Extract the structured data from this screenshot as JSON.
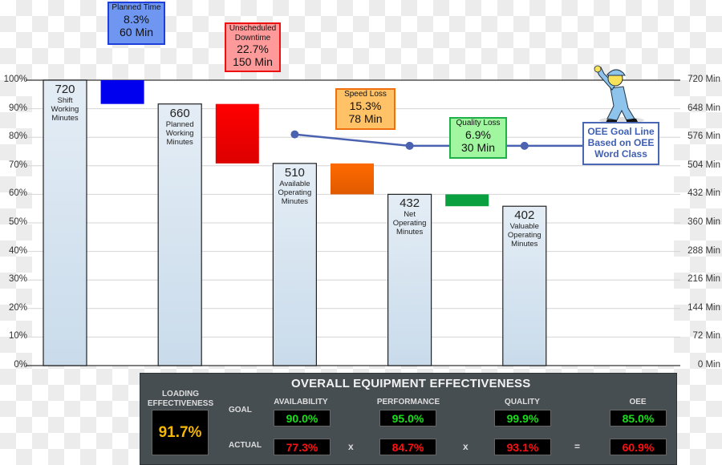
{
  "chart_data": {
    "type": "bar",
    "subtype": "waterfall",
    "title": "Overall Equipment Effectiveness",
    "left_axis": {
      "ticks": [
        "0%",
        "10%",
        "20%",
        "30%",
        "40%",
        "50%",
        "60%",
        "70%",
        "80%",
        "90%",
        "100%"
      ],
      "range": [
        0,
        100
      ]
    },
    "right_axis": {
      "ticks": [
        "0 Min",
        "72 Min",
        "144 Min",
        "216 Min",
        "288 Min",
        "360 Min",
        "432 Min",
        "504 Min",
        "576 Min",
        "648 Min",
        "720 Min"
      ],
      "range": [
        0,
        720
      ]
    },
    "grid": true,
    "bars": [
      {
        "kind": "total",
        "value": 720,
        "label": "720",
        "desc": [
          "Shift",
          "Working",
          "Minutes"
        ],
        "color": "#d6e4f0"
      },
      {
        "kind": "loss",
        "from": 720,
        "to": 660,
        "color": "#0000ee",
        "callout": {
          "title": "Planned Time",
          "pct": "8.3%",
          "min": "60 Min",
          "bg": "#6f96f0",
          "border": "#1f3fdd"
        }
      },
      {
        "kind": "total",
        "value": 660,
        "label": "660",
        "desc": [
          "Planned",
          "Working",
          "Minutes"
        ],
        "color": "#d6e4f0"
      },
      {
        "kind": "loss",
        "from": 660,
        "to": 510,
        "color": "#ee0000",
        "callout": {
          "title": "Unscheduled Downtime",
          "pct": "22.7%",
          "min": "150 Min",
          "bg": "#ff9a9a",
          "border": "#ee1111"
        }
      },
      {
        "kind": "total",
        "value": 510,
        "label": "510",
        "desc": [
          "Available",
          "Operating",
          "Minutes"
        ],
        "color": "#d6e4f0"
      },
      {
        "kind": "loss",
        "from": 510,
        "to": 432,
        "color": "#f06a00",
        "callout": {
          "title": "Speed Loss",
          "pct": "15.3%",
          "min": "78 Min",
          "bg": "#ffc266",
          "border": "#f07010"
        }
      },
      {
        "kind": "total",
        "value": 432,
        "label": "432",
        "desc": [
          "Net",
          "Operating",
          "Minutes"
        ],
        "color": "#d6e4f0"
      },
      {
        "kind": "loss",
        "from": 432,
        "to": 402,
        "color": "#0aa040",
        "callout": {
          "title": "Quality Loss",
          "pct": "6.9%",
          "min": "30 Min",
          "bg": "#a0f7a0",
          "border": "#1fb04a"
        }
      },
      {
        "kind": "total",
        "value": 402,
        "label": "402",
        "desc": [
          "Valuable",
          "Operating",
          "Minutes"
        ],
        "color": "#d6e4f0"
      }
    ],
    "goal_line": {
      "points_pct": [
        81,
        77,
        77
      ],
      "at_bars": [
        4,
        6,
        8
      ],
      "color": "#4a62b0",
      "label": [
        "OEE Goal Line",
        "Based on OEE",
        "Word Class"
      ]
    }
  },
  "panel": {
    "title": "OVERALL EQUIPMENT EFFECTIVENESS",
    "loading_label": [
      "LOADING",
      "EFFECTIVENESS"
    ],
    "loading_value": "91.7%",
    "row_labels": {
      "goal": "GOAL",
      "actual": "ACTUAL"
    },
    "columns": [
      {
        "name": "AVAILABILITY",
        "goal": "90.0%",
        "actual": "77.3%"
      },
      {
        "name": "PERFORMANCE",
        "goal": "95.0%",
        "actual": "84.7%"
      },
      {
        "name": "QUALITY",
        "goal": "99.9%",
        "actual": "93.1%"
      },
      {
        "name": "OEE",
        "goal": "85.0%",
        "actual": "60.9%"
      }
    ],
    "operators": [
      "x",
      "x",
      "="
    ],
    "colors": {
      "goal": "#18e018",
      "actual": "#ff1010",
      "loading": "#f5b800",
      "panel_bg": "#474e52"
    }
  }
}
